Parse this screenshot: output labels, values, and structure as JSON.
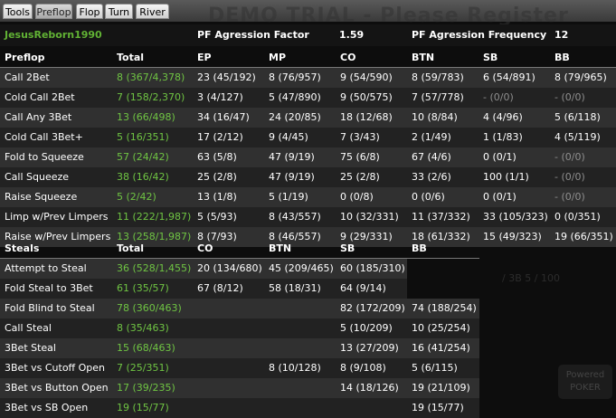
{
  "tabs": [
    "Tools",
    "Preflop",
    "Flop",
    "Turn",
    "River"
  ],
  "active_tab": "Preflop",
  "background_text": {
    "title": "DEMO TRIAL - Please Register",
    "fragment": "/ 3B 5 / 100",
    "logo": "Powered POKER"
  },
  "player": {
    "name": "JesusReborn1990",
    "pf_agression_factor_label": "PF Agression Factor",
    "pf_agression_factor_value": "1.59",
    "pf_agression_frequency_label": "PF Agression Frequency",
    "pf_agression_frequency_value": "12"
  },
  "preflop": {
    "headers": [
      "Preflop",
      "Total",
      "EP",
      "MP",
      "CO",
      "BTN",
      "SB",
      "BB"
    ],
    "rows": [
      [
        "Call 2Bet",
        "8 (367/4,378)",
        "23 (45/192)",
        "8 (76/957)",
        "9 (54/590)",
        "8 (59/783)",
        "6 (54/891)",
        "8 (79/965)"
      ],
      [
        "Cold Call 2Bet",
        "7 (158/2,370)",
        "3 (4/127)",
        "5 (47/890)",
        "9 (50/575)",
        "7 (57/778)",
        "- (0/0)",
        "- (0/0)"
      ],
      [
        "Call Any 3Bet",
        "13 (66/498)",
        "34 (16/47)",
        "24 (20/85)",
        "18 (12/68)",
        "10 (8/84)",
        "4 (4/96)",
        "5 (6/118)"
      ],
      [
        "Cold Call 3Bet+",
        "5 (16/351)",
        "17 (2/12)",
        "9 (4/45)",
        "7 (3/43)",
        "2 (1/49)",
        "1 (1/83)",
        "4 (5/119)"
      ],
      [
        "Fold to Squeeze",
        "57 (24/42)",
        "63 (5/8)",
        "47 (9/19)",
        "75 (6/8)",
        "67 (4/6)",
        "0 (0/1)",
        "- (0/0)"
      ],
      [
        "Call Squeeze",
        "38 (16/42)",
        "25 (2/8)",
        "47 (9/19)",
        "25 (2/8)",
        "33 (2/6)",
        "100 (1/1)",
        "- (0/0)"
      ],
      [
        "Raise Squeeze",
        "5 (2/42)",
        "13 (1/8)",
        "5 (1/19)",
        "0 (0/8)",
        "0 (0/6)",
        "0 (0/1)",
        "- (0/0)"
      ],
      [
        "Limp w/Prev Limpers",
        "11 (222/1,987)",
        "5 (5/93)",
        "8 (43/557)",
        "10 (32/331)",
        "11 (37/332)",
        "33 (105/323)",
        "0 (0/351)"
      ],
      [
        "Raise w/Prev Limpers",
        "13 (258/1,987)",
        "8 (7/93)",
        "8 (46/557)",
        "9 (29/331)",
        "18 (61/332)",
        "15 (49/323)",
        "19 (66/351)"
      ]
    ]
  },
  "steals": {
    "headers": [
      "Steals",
      "Total",
      "CO",
      "BTN",
      "SB",
      "BB"
    ],
    "rows": [
      [
        "Attempt to Steal",
        "36 (528/1,455)",
        "20 (134/680)",
        "45 (209/465)",
        "60 (185/310)",
        ""
      ],
      [
        "Fold Steal to 3Bet",
        "61 (35/57)",
        "67 (8/12)",
        "58 (18/31)",
        "64 (9/14)",
        ""
      ],
      [
        "Fold Blind to Steal",
        "78 (360/463)",
        "",
        "",
        "82 (172/209)",
        "74 (188/254)"
      ],
      [
        "Call Steal",
        "8 (35/463)",
        "",
        "",
        "5 (10/209)",
        "10 (25/254)"
      ],
      [
        "3Bet Steal",
        "15 (68/463)",
        "",
        "",
        "13 (27/209)",
        "16 (41/254)"
      ],
      [
        "3Bet vs Cutoff Open",
        "7 (25/351)",
        "",
        "8 (10/128)",
        "8 (9/108)",
        "5 (6/115)"
      ],
      [
        "3Bet vs Button Open",
        "17 (39/235)",
        "",
        "",
        "14 (18/126)",
        "19 (21/109)"
      ],
      [
        "3Bet vs SB Open",
        "19 (15/77)",
        "",
        "",
        "",
        "19 (15/77)"
      ]
    ]
  },
  "colors": {
    "player_name": "#61b234",
    "total_value": "#6fc443",
    "muted_value": "#8e8e8e",
    "row_dark": "#303030",
    "row_light": "#222222"
  }
}
